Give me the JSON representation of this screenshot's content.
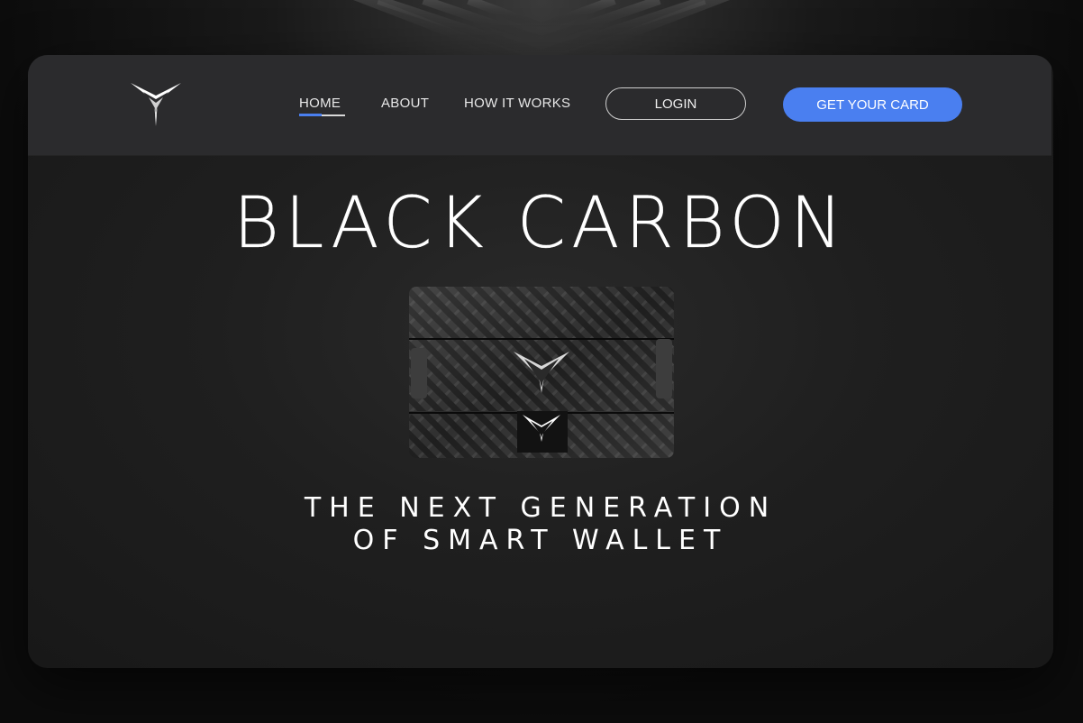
{
  "nav": {
    "home": "HOME",
    "about": "ABOUT",
    "how_it_works": "HOW IT WORKS",
    "login": "LOGIN",
    "get_card": "GET YOUR CARD"
  },
  "hero": {
    "title": "BLACK CARBON",
    "tagline_line1": "THE NEXT GENERATION",
    "tagline_line2": "OF SMART WALLET"
  },
  "icons": {
    "brand_logo": "chevron-v-logo"
  },
  "colors": {
    "accent": "#4a7ff0",
    "navbar": "#2b2b2d",
    "background": "#1f1f1f",
    "text": "#ffffff"
  }
}
